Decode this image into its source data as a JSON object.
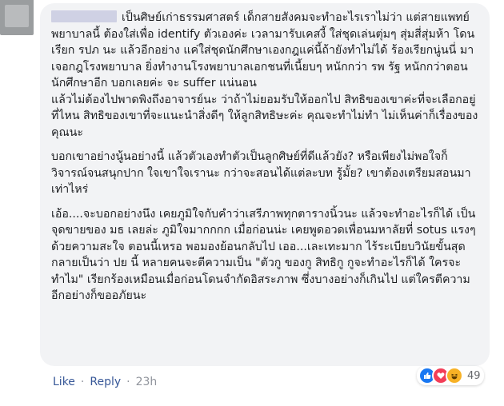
{
  "comment": {
    "paragraphs": [
      "เป็นศิษย์เก่าธรรมศาสตร์ เด็กสายสังคมจะทำอะไรเราไม่ว่า แต่สายแพทย์ พยาบาลนี้ ต้องใส่เพื่อ identify ตัวเองค่ะ เวลามารับเคสงี้ ใส่ชุดเล่นตุ่มๆ สุ่มสี่สุ่มห้า โดนเรียก รปภ นะ แล้วอีกอย่าง แค่ใส่ชุดนักศึกษาเองกฎแค่นี้ถ้ายังทำไม่ได้ ร้องเรียกนู่นนี่ มาเจอกฎโรงพยาบาล ยิ่งทำงานโรงพยาบาลเอกชนที่เนี้ยบๆ หนักกว่า รพ รัฐ หนักกว่าตอนนักศึกษาอีก บอกเลยค่ะ จะ suffer แน่นอน\nแล้วไม่ต้องไปพาดพิงถึงอาจารย์นะ ว่าถ้าไม่ยอมรับให้ออกไป สิทธิของเขาค่ะที่จะเลือกอยู่ที่ไหน สิทธิของเขาที่จะแนะนำสิ่งดีๆ ให้ลูกสิทธิษะค่ะ คุณจะทำไม่ทำ ไม่เห็นค่าก็เรื่องของคุณนะ",
      "บอกเขาอย่างนู้นอย่างนี้ แล้วตัวเองทำตัวเป็นลูกศิษย์ที่ดีแล้วยัง? หรือเพียงไม่พอใจก็วิจารณ์จนสนุกปาก ใจเขาใจเรานะ กว่าจะสอนได้แต่ละบท รู้มั้ย? เขาต้องเตรียมสอนมาเท่าไหร่",
      "เอ้อ....จะบอกอย่างนึง เคยภูมิใจกับคำว่าเสรีภาพทุกตารางนิ้วนะ แล้วจะทำอะไรก็ได้ เป็นจุดขายของ มธ เลยล่ะ ภูมิใจมากกกก เมื่อก่อนน่ะ เคยพูดอวดเพื่อนมหาลัยที่ sotus แรงๆ ด้วยความสะใจ ตอนนี้เหรอ พอมองย้อนกลับไป เออ...เละเทะมาก ไร้ระเบียบวินัยขั้นสุด กลายเป็นว่า ปย นี้ หลายคนจะตีความเป็น \"ตัวกู ของกู สิทธิกู กูจะทำอะไรก็ได้ ใครจะทำไม\" เรียกร้องเหมือนเมื่อก่อนโดนจำกัดอิสระภาพ ซึ่งบางอย่างก็เกินไป แต่ใครตีความอีกอย่างก็ขออภัยนะ"
    ]
  },
  "reactions": {
    "icons": [
      "like-icon",
      "love-icon",
      "haha-icon"
    ],
    "count": "49"
  },
  "actions": {
    "like_label": "Like",
    "separator": "·",
    "reply_label": "Reply",
    "timestamp": "23h"
  },
  "colors": {
    "bubble_bg": "#f2f3f5",
    "link": "#385898",
    "like": "#1877f2",
    "love": "#f33e58",
    "haha": "#f7b125"
  }
}
